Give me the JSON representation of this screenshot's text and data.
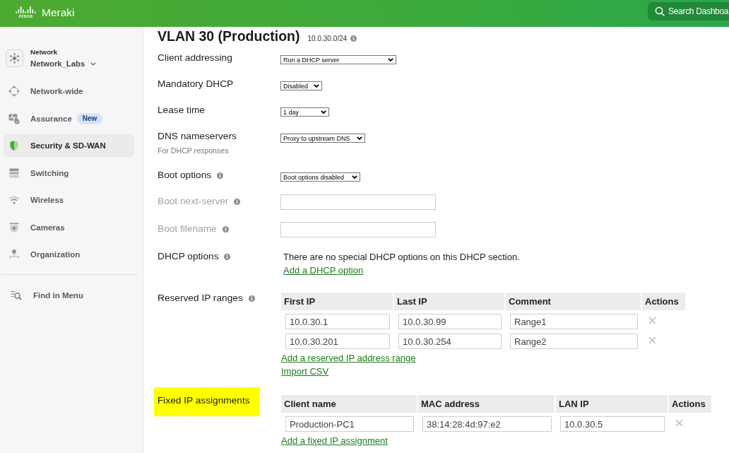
{
  "header": {
    "logo": {
      "mark": "cisco",
      "name": "Meraki"
    },
    "search": {
      "label": "Search Dashboa"
    }
  },
  "sidebar": {
    "network": {
      "label": "Network",
      "name": "Network_Labs"
    },
    "items": [
      {
        "label": "Network-wide",
        "selected": false
      },
      {
        "label": "Assurance",
        "selected": false,
        "badge": "New"
      },
      {
        "label": "Security & SD-WAN",
        "selected": true
      },
      {
        "label": "Switching",
        "selected": false
      },
      {
        "label": "Wireless",
        "selected": false
      },
      {
        "label": "Cameras",
        "selected": false
      },
      {
        "label": "Organization",
        "selected": false
      }
    ],
    "find": {
      "label": "Find in Menu"
    }
  },
  "page": {
    "title": "VLAN 30 (Production)",
    "subnet": "10.0.30.0/24"
  },
  "rows": [
    {
      "kind": "select",
      "label": "Client addressing",
      "info": false,
      "disabled": false,
      "highlighted": false,
      "value": "Run a DHCP server"
    },
    {
      "kind": "select",
      "label": "Mandatory DHCP",
      "info": false,
      "disabled": false,
      "highlighted": false,
      "value": "Disabled"
    },
    {
      "kind": "select",
      "label": "Lease time",
      "info": false,
      "disabled": false,
      "highlighted": false,
      "value": "1 day"
    },
    {
      "kind": "select",
      "label": "DNS nameservers",
      "hint": "For DHCP responses",
      "info": false,
      "disabled": false,
      "highlighted": false,
      "value": "Proxy to upstream DNS"
    },
    {
      "kind": "select",
      "label": "Boot options",
      "info": true,
      "disabled": false,
      "highlighted": false,
      "value": "Boot options disabled"
    },
    {
      "kind": "input",
      "label": "Boot next-server",
      "info": true,
      "disabled": true,
      "highlighted": false
    },
    {
      "kind": "input",
      "label": "Boot filename",
      "info": true,
      "disabled": true,
      "highlighted": false
    },
    {
      "kind": "text",
      "label": "DHCP options",
      "info": true,
      "disabled": false,
      "highlighted": false,
      "text": "There are no special DHCP options on this DHCP section.",
      "links": [
        "Add a DHCP option"
      ]
    },
    {
      "kind": "table",
      "label": "Reserved IP ranges",
      "info": true,
      "disabled": false,
      "highlighted": false,
      "columns": [
        "First IP",
        "Last IP",
        "Comment",
        "Actions"
      ],
      "rows": [
        [
          "10.0.30.1",
          "10.0.30.99",
          "Range1"
        ],
        [
          "10.0.30.201",
          "10.0.30.254",
          "Range2"
        ]
      ],
      "links": [
        "Add a reserved IP address range",
        "Import CSV"
      ]
    },
    {
      "kind": "table",
      "label": "Fixed IP assignments",
      "info": false,
      "disabled": false,
      "highlighted": true,
      "columns": [
        "Client name",
        "MAC address",
        "LAN IP",
        "Actions"
      ],
      "rows": [
        [
          "Production-PC1",
          "38:14:28:4d:97:e2",
          "10.0.30.5"
        ]
      ],
      "links": [
        "Add a fixed IP assignment"
      ]
    }
  ]
}
